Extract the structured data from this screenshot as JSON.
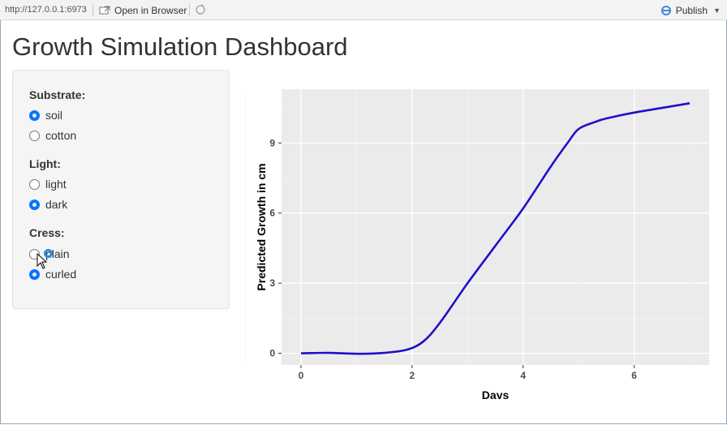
{
  "toolbar": {
    "url": "http://127.0.0.1:6973",
    "open_browser_label": "Open in Browser",
    "publish_label": "Publish"
  },
  "page": {
    "title": "Growth Simulation Dashboard"
  },
  "controls": {
    "substrate": {
      "label": "Substrate:",
      "options": [
        "soil",
        "cotton"
      ],
      "selected": "soil"
    },
    "light": {
      "label": "Light:",
      "options": [
        "light",
        "dark"
      ],
      "selected": "dark"
    },
    "cress": {
      "label": "Cress:",
      "options": [
        "plain",
        "curled"
      ],
      "selected": "curled"
    }
  },
  "colors": {
    "line": "#1f10c8",
    "panel_bg": "#ebebeb",
    "radio_accent": "#0075ff"
  },
  "chart_data": {
    "type": "line",
    "xlabel": "Days",
    "ylabel": "Predicted Growth in cm",
    "xlim": [
      -0.35,
      7.35
    ],
    "ylim": [
      -0.5,
      11.3
    ],
    "xticks": [
      0,
      2,
      4,
      6
    ],
    "yticks": [
      0,
      3,
      6,
      9
    ],
    "grid": true,
    "series": [
      {
        "x": [
          0,
          0.5,
          1,
          1.5,
          1.9,
          2.2,
          2.5,
          3,
          3.5,
          4,
          4.5,
          4.8,
          5,
          5.3,
          5.5,
          6,
          6.5,
          7
        ],
        "values": [
          0,
          0.02,
          -0.02,
          0.02,
          0.15,
          0.5,
          1.3,
          3.0,
          4.6,
          6.2,
          8.0,
          9.0,
          9.6,
          9.9,
          10.05,
          10.3,
          10.5,
          10.7
        ]
      }
    ]
  }
}
